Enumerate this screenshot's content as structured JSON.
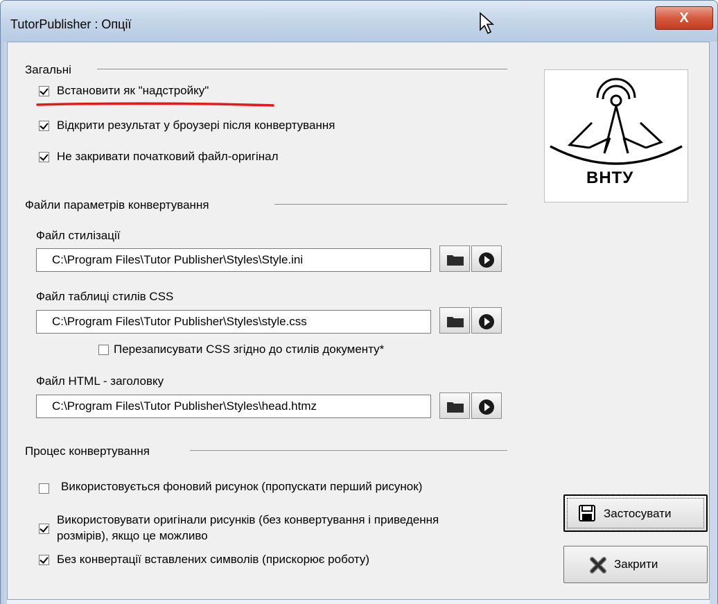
{
  "window": {
    "title": "TutorPublisher : Опції",
    "close_label": "X"
  },
  "general": {
    "label": "Загальні",
    "checkboxes": [
      {
        "label": "Встановити як \"надстройку\"",
        "checked": true
      },
      {
        "label": "Відкрити результат у броузері після конвертування",
        "checked": true
      },
      {
        "label": "Не закривати початковий файл-оригінал",
        "checked": true
      }
    ]
  },
  "logo": {
    "text": "ВНТУ"
  },
  "params": {
    "label": "Файли параметрів конвертування",
    "style_file": {
      "label": "Файл стилізації",
      "value": "C:\\Program Files\\Tutor Publisher\\Styles\\Style.ini"
    },
    "css_file": {
      "label": "Файл таблиці стилів CSS",
      "value": "C:\\Program Files\\Tutor Publisher\\Styles\\style.css"
    },
    "overwrite_css": {
      "label": "Перезаписувати CSS згідно до стилів документу*",
      "checked": false
    },
    "html_file": {
      "label": "Файл HTML - заголовку",
      "value": "C:\\Program Files\\Tutor Publisher\\Styles\\head.htmz"
    }
  },
  "process": {
    "label": "Процес конвертування",
    "bg_image": {
      "label": "Використовується фоновий рисунок (пропускати перший рисунок)",
      "checked": false
    },
    "orig_images": {
      "line1": "Використовувати оригінали рисунків (без конвертування і приведення",
      "line2": "розмірів), якщо це можливо",
      "checked": true
    },
    "no_convert": {
      "label": "Без конвертації вставлених символів (прискорює роботу)",
      "checked": true
    }
  },
  "buttons": {
    "apply": "Застосувати",
    "close": "Закрити"
  },
  "colors": {
    "annotation_underline": "#e41a1a",
    "close_button": "#c9472b"
  }
}
